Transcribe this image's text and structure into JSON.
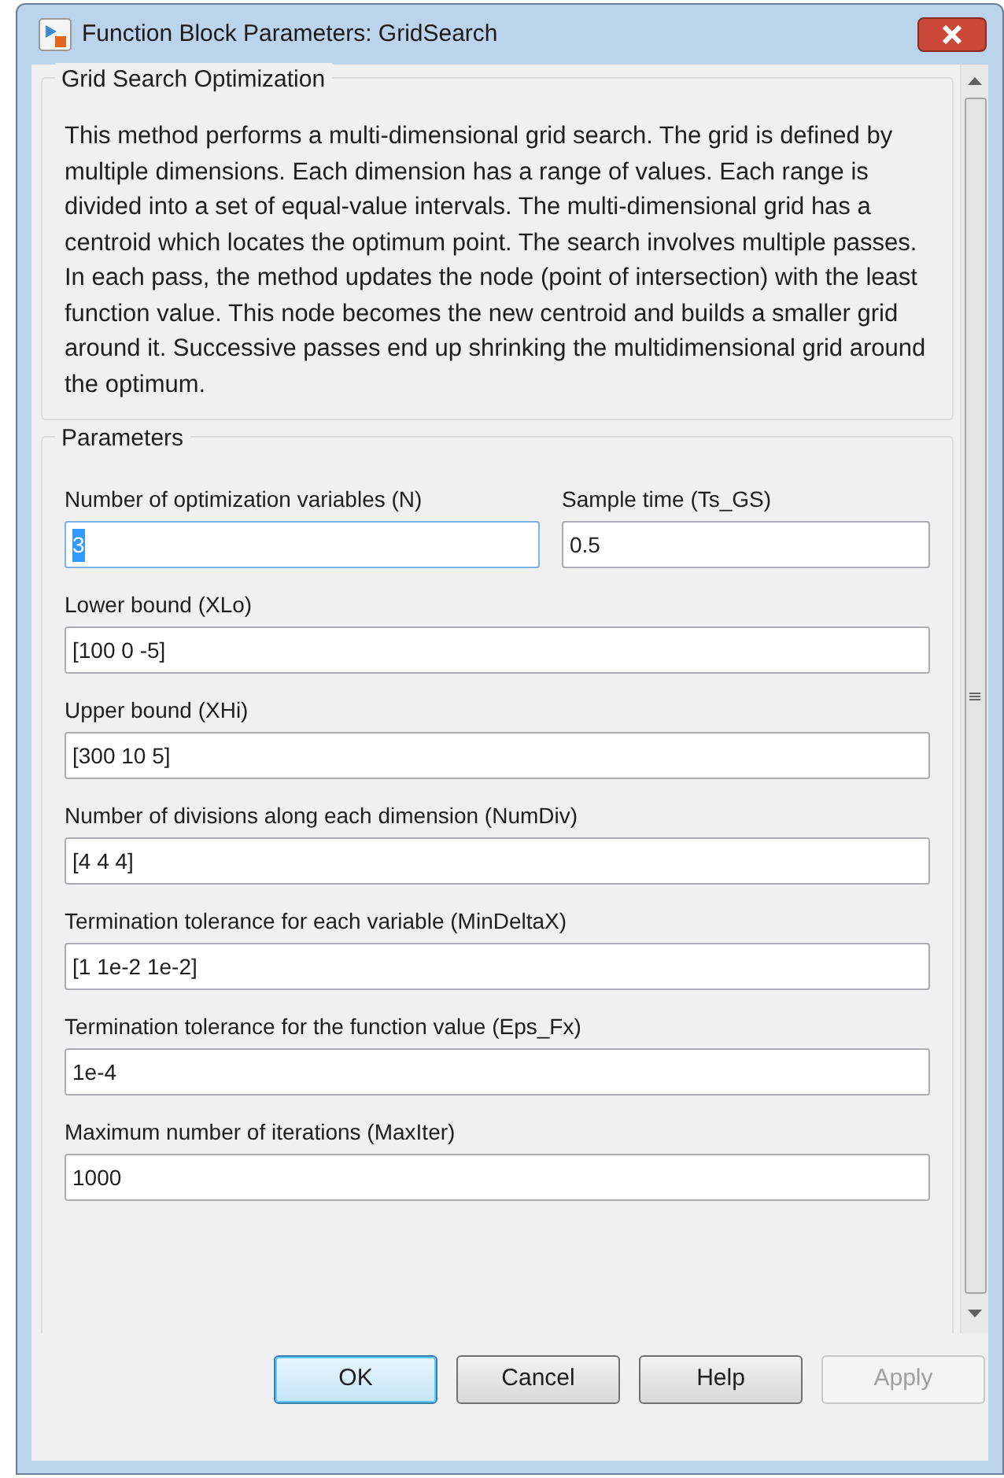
{
  "window": {
    "title": "Function Block Parameters: GridSearch"
  },
  "description": {
    "title": "Grid Search Optimization",
    "text": "This method performs a multi-dimensional grid search. The grid is defined by multiple dimensions. Each dimension has a range of values. Each range is divided into a set of equal-value intervals. The multi-dimensional grid has a centroid which locates the optimum point. The search involves multiple passes. In each pass, the method updates the node (point of intersection) with the least function value. This node becomes the new centroid and builds a smaller grid around it. Successive passes end up shrinking the multidimensional grid around the optimum."
  },
  "parameters": {
    "title": "Parameters",
    "row": [
      {
        "label": "Number of optimization variables (N)",
        "value": "3",
        "focused": true
      },
      {
        "label": "Sample time (Ts_GS)",
        "value": "0.5",
        "focused": false
      }
    ],
    "fields": [
      {
        "label": "Lower bound (XLo)",
        "value": "[100 0 -5]",
        "focused": false
      },
      {
        "label": "Upper bound (XHi)",
        "value": "[300 10 5]",
        "focused": false
      },
      {
        "label": "Number of divisions along each dimension (NumDiv)",
        "value": "[4 4 4]",
        "focused": false
      },
      {
        "label": "Termination tolerance for each variable (MinDeltaX)",
        "value": "[1 1e-2 1e-2]",
        "focused": false
      },
      {
        "label": "Termination tolerance for the function value (Eps_Fx)",
        "value": "1e-4",
        "focused": false
      },
      {
        "label": "Maximum number of iterations (MaxIter)",
        "value": "1000",
        "focused": false
      }
    ]
  },
  "buttons": [
    {
      "label": "OK",
      "default": true,
      "disabled": false
    },
    {
      "label": "Cancel",
      "default": false,
      "disabled": false
    },
    {
      "label": "Help",
      "default": false,
      "disabled": false
    },
    {
      "label": "Apply",
      "default": false,
      "disabled": true
    }
  ]
}
